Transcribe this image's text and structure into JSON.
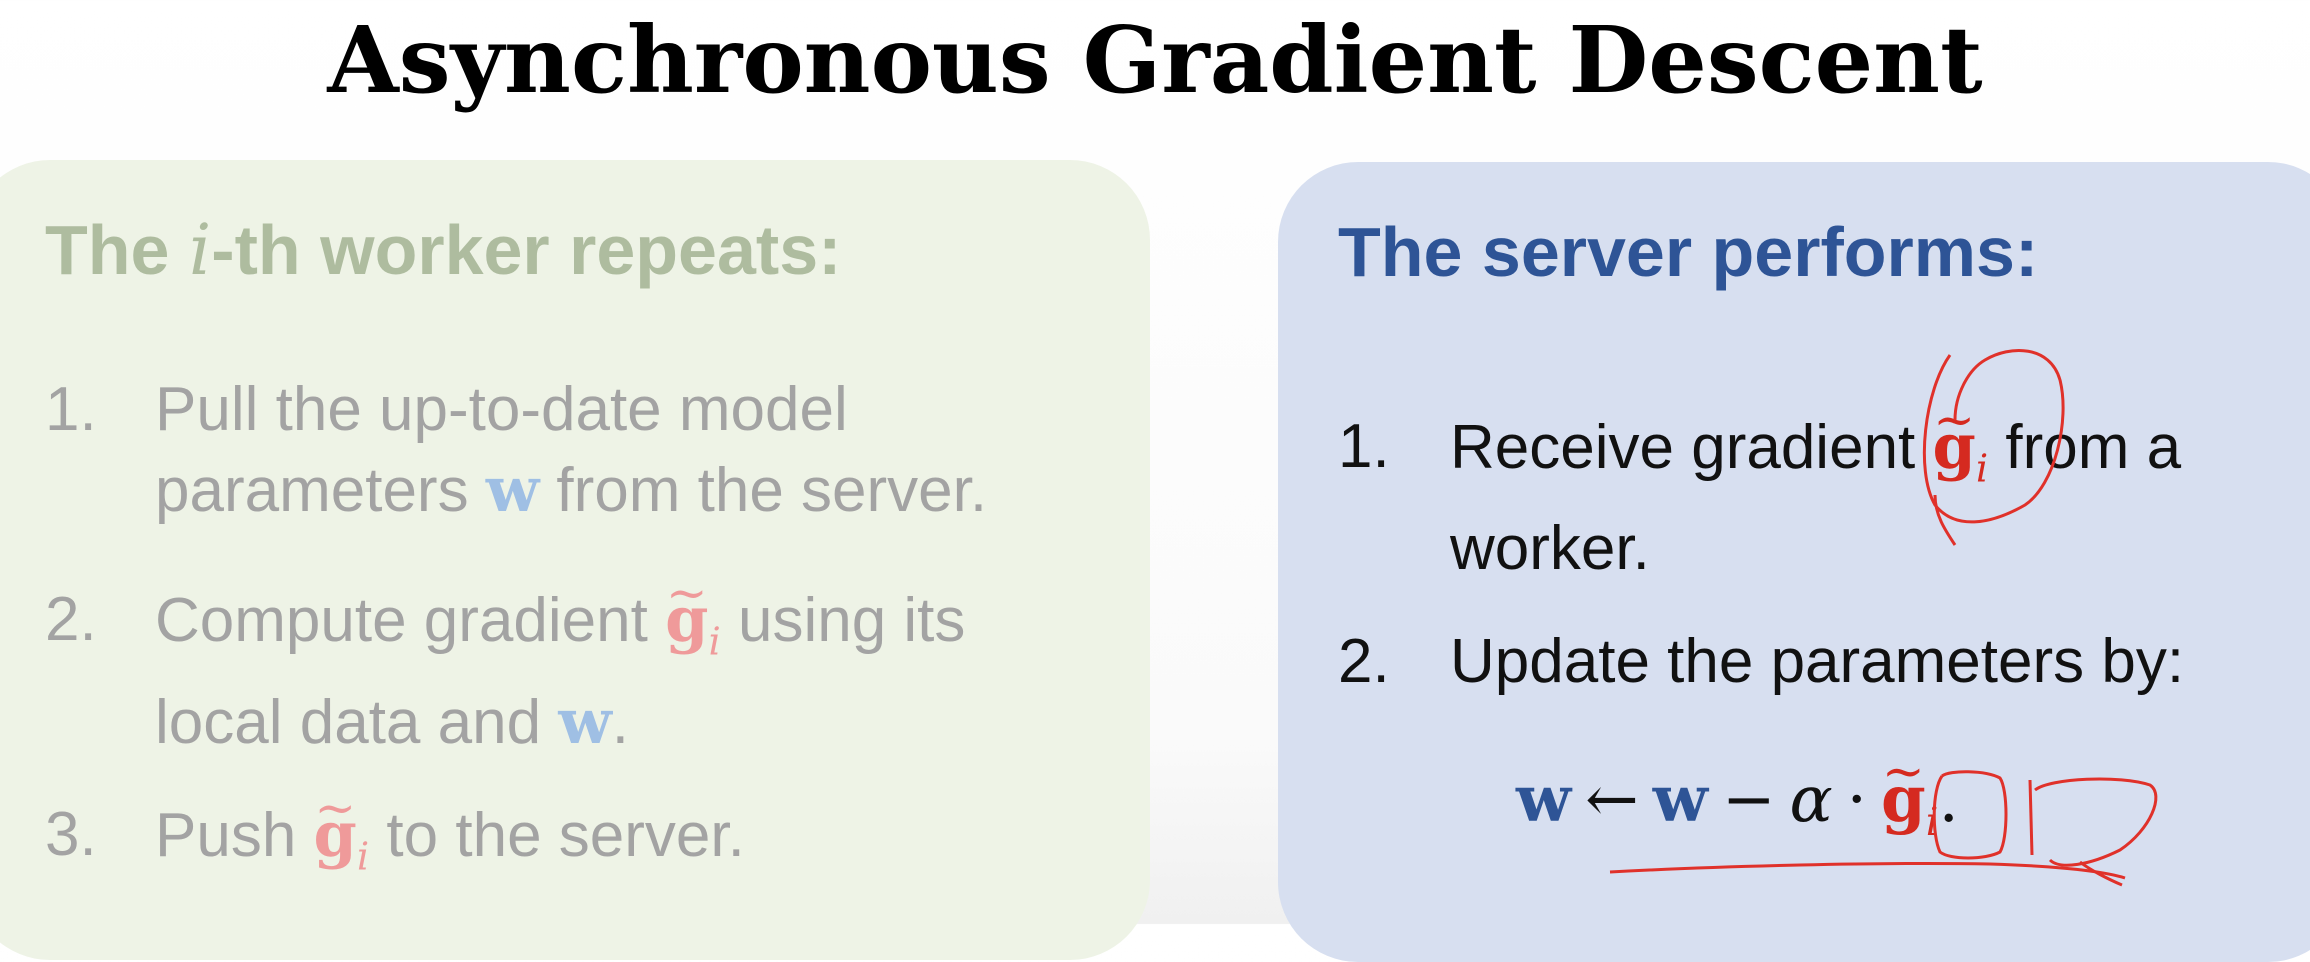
{
  "title": "Asynchronous Gradient Descent",
  "worker": {
    "heading_pre": "The ",
    "heading_i": "i",
    "heading_post": "-th worker repeats:",
    "steps": [
      {
        "num": "1.",
        "line1": "Pull the up-to-date model",
        "line2_pre": "parameters ",
        "w": "w",
        "line2_post": " from the server."
      },
      {
        "num": "2.",
        "line1_pre": "Compute gradient ",
        "g": "g",
        "g_sub": "i",
        "line1_post": " using its",
        "line2_pre": "local data and ",
        "w": "w",
        "line2_post": "."
      },
      {
        "num": "3.",
        "pre": "Push ",
        "g": "g",
        "g_sub": "i",
        "post": " to the server."
      }
    ]
  },
  "server": {
    "heading": "The server performs:",
    "steps": [
      {
        "num": "1.",
        "line1_pre": "Receive gradient ",
        "g": "g",
        "g_sub": "i",
        "line1_post": " from a",
        "line2": "worker."
      },
      {
        "num": "2.",
        "text": "Update the parameters by:"
      }
    ],
    "equation": {
      "lhs": "w",
      "arrow": "←",
      "w": "w",
      "minus": "−",
      "alpha": "α",
      "dot": "·",
      "g": "g",
      "g_sub": "i",
      "end": "."
    }
  },
  "colors": {
    "worker_bg": "#eef3e6",
    "server_bg": "#d7dff0",
    "server_heading": "#2e5496",
    "vector_w": "#2e5496",
    "vector_g": "#d52a20",
    "annotation": "#e0312a"
  }
}
